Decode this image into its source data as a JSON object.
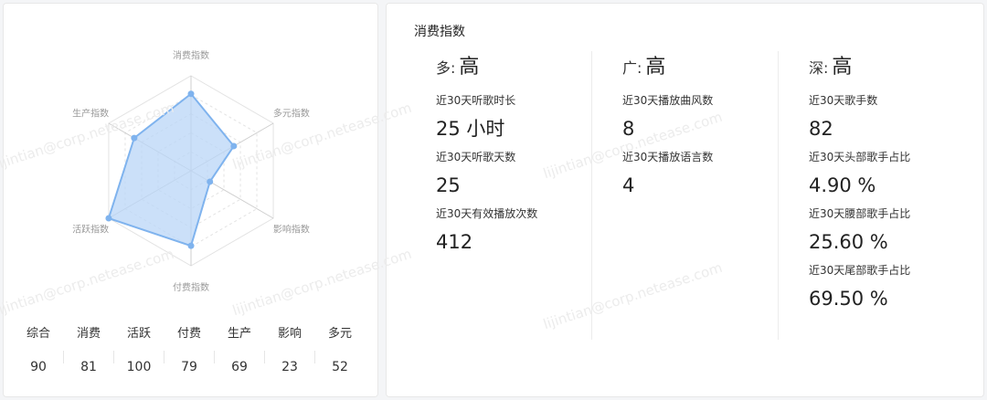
{
  "radar": {
    "axes": [
      "消费指数",
      "多元指数",
      "影响指数",
      "付费指数",
      "活跃指数",
      "生产指数"
    ],
    "values": [
      81,
      52,
      23,
      79,
      100,
      69
    ],
    "max": 100,
    "colors": {
      "fill": "#b9d6f7",
      "stroke": "#7fb3ee",
      "point": "#7fb3ee"
    }
  },
  "scores": [
    {
      "label": "综合",
      "value": "90"
    },
    {
      "label": "消费",
      "value": "81"
    },
    {
      "label": "活跃",
      "value": "100"
    },
    {
      "label": "付费",
      "value": "79"
    },
    {
      "label": "生产",
      "value": "69"
    },
    {
      "label": "影响",
      "value": "23"
    },
    {
      "label": "多元",
      "value": "52"
    }
  ],
  "detail": {
    "title": "消费指数",
    "columns": [
      {
        "head": "多:",
        "level": "高",
        "metrics": [
          {
            "label": "近30天听歌时长",
            "value": "25 小时"
          },
          {
            "label": "近30天听歌天数",
            "value": "25"
          },
          {
            "label": "近30天有效播放次数",
            "value": "412"
          }
        ]
      },
      {
        "head": "广:",
        "level": "高",
        "metrics": [
          {
            "label": "近30天播放曲风数",
            "value": "8"
          },
          {
            "label": "近30天播放语言数",
            "value": "4"
          }
        ]
      },
      {
        "head": "深:",
        "level": "高",
        "metrics": [
          {
            "label": "近30天歌手数",
            "value": "82"
          },
          {
            "label": "近30天头部歌手占比",
            "value": "4.90 %"
          },
          {
            "label": "近30天腰部歌手占比",
            "value": "25.60 %"
          },
          {
            "label": "近30天尾部歌手占比",
            "value": "69.50 %"
          }
        ]
      }
    ]
  },
  "watermark": "lijintian@corp.netease.com"
}
